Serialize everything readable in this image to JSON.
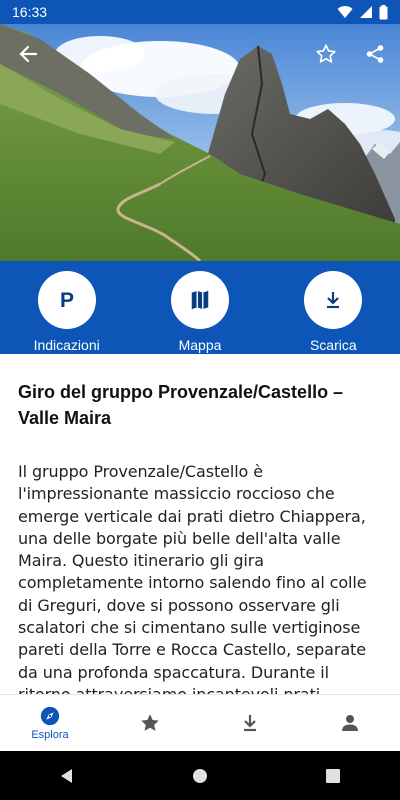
{
  "status_bar": {
    "time": "16:33"
  },
  "hero": {
    "alt": "Torre e Rocca Castello"
  },
  "actions": [
    {
      "label": "Indicazioni",
      "icon": "parking-icon"
    },
    {
      "label": "Mappa",
      "icon": "map-icon"
    },
    {
      "label": "Scarica",
      "icon": "download-icon"
    }
  ],
  "content": {
    "title": "Giro del gruppo Provenzale/Castello – Valle Maira",
    "description": "Il gruppo Provenzale/Castello è l'impressionante massiccio roccioso che emerge verticale dai prati dietro Chiappera, una delle borgate più belle dell'alta valle Maira. Questo itinerario gli gira completamente intorno salendo fino al colle di Greguri, dove si possono osservare gli scalatori che si cimentano sulle vertiginose pareti della Torre e Rocca Castello, separate da una profonda spaccatura. Durante il ritorno attraversiamo incantevoli prati"
  },
  "bottom_nav": {
    "explore_label": "Esplora"
  },
  "colors": {
    "primary": "#0d56b8"
  }
}
